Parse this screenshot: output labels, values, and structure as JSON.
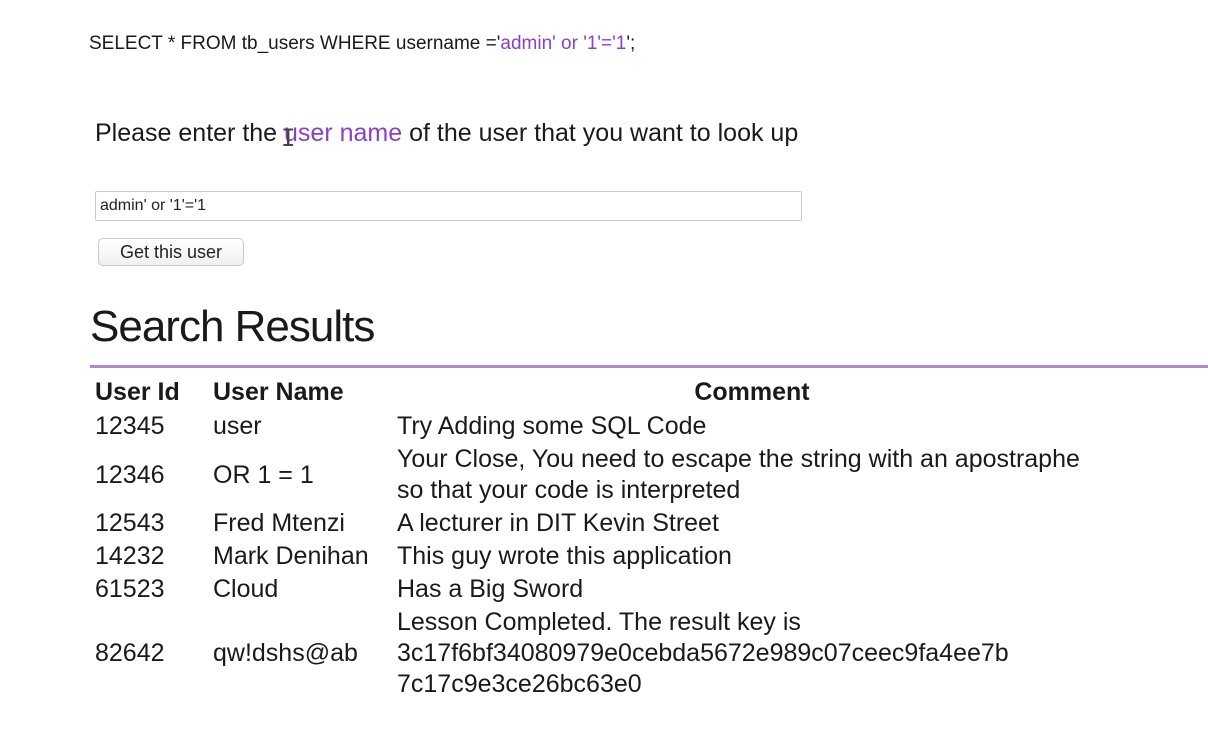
{
  "sql": {
    "prefix": "SELECT * FROM tb_users WHERE username ='",
    "injected": "admin' or '1'='1",
    "suffix": "';"
  },
  "prompt": {
    "before": "Please enter the ",
    "highlight": "user name",
    "after": " of the user that you want to look up"
  },
  "form": {
    "input_value": "admin' or '1'='1",
    "button_label": "Get this user"
  },
  "results": {
    "heading": "Search Results",
    "columns": [
      "User Id",
      "User Name",
      "Comment"
    ],
    "rows": [
      {
        "id": "12345",
        "name": "user",
        "comment": "Try Adding some SQL Code"
      },
      {
        "id": "12346",
        "name": "OR 1 = 1",
        "comment": "Your Close, You need to escape the string with an apostraphe so that your code is interpreted"
      },
      {
        "id": "12543",
        "name": "Fred Mtenzi",
        "comment": "A lecturer in DIT Kevin Street"
      },
      {
        "id": "14232",
        "name": "Mark Denihan",
        "comment": "This guy wrote this application"
      },
      {
        "id": "61523",
        "name": "Cloud",
        "comment": "Has a Big Sword"
      },
      {
        "id": "82642",
        "name": "qw!dshs@ab",
        "comment": "Lesson Completed. The result key is 3c17f6bf34080979e0cebda5672e989c07ceec9fa4ee7b 7c17c9e3ce26bc63e0"
      }
    ]
  },
  "colors": {
    "accent_purple": "#8a3fc9",
    "divider": "#b487d6"
  }
}
